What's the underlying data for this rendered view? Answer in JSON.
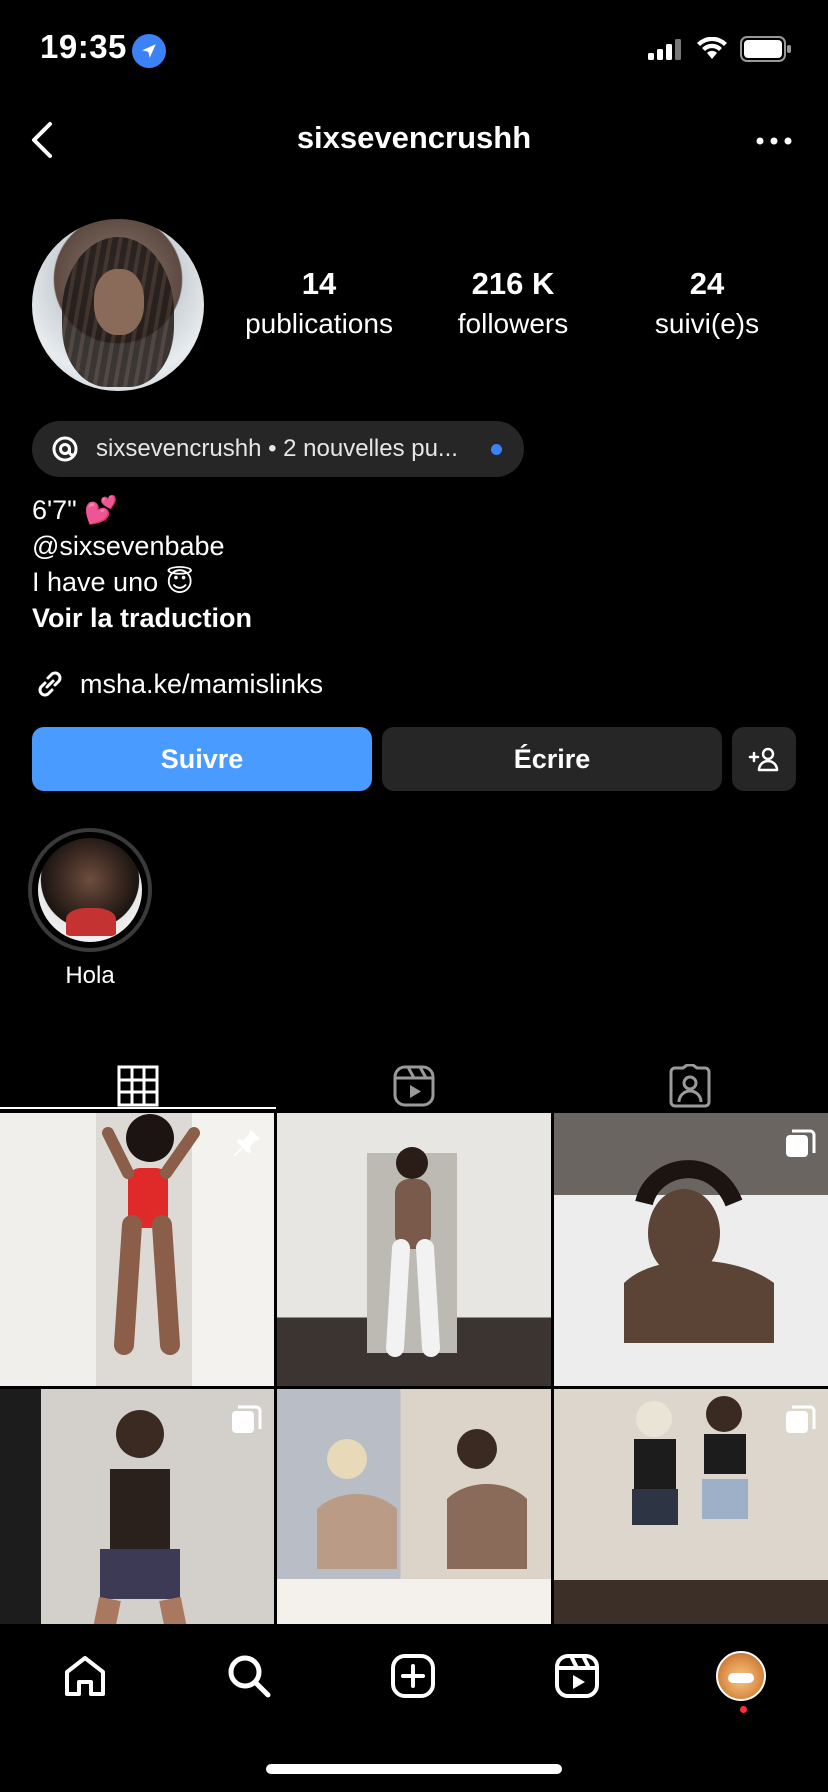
{
  "status_bar": {
    "time": "19:35",
    "icons": [
      "location-arrow-icon",
      "signal-icon",
      "wifi-icon",
      "battery-icon"
    ]
  },
  "header": {
    "username": "sixsevencrushh",
    "icons": [
      "back-chevron-icon",
      "more-dots-icon"
    ]
  },
  "stats": [
    {
      "value": "14",
      "label": "publications"
    },
    {
      "value": "216 K",
      "label": "followers"
    },
    {
      "value": "24",
      "label": "suivi(e)s"
    }
  ],
  "threads_pill": {
    "text": "sixsevencrushh • 2 nouvelles pu..."
  },
  "bio": {
    "line1": "6'7\" 💕",
    "line2": "@sixsevenbabe",
    "line3": "I have uno 😇",
    "translate": "Voir la traduction"
  },
  "link": {
    "text": "msha.ke/mamislinks"
  },
  "actions": {
    "follow": "Suivre",
    "message": "Écrire"
  },
  "highlights": [
    {
      "label": "Hola"
    }
  ],
  "tabs": [
    "grid-icon",
    "reels-icon",
    "tagged-icon"
  ],
  "grid": [
    {
      "badge": "pin-icon",
      "bg": "#e9e6e2",
      "accent": "#e02a2a"
    },
    {
      "badge": "",
      "bg": "#dcdad6",
      "accent": "#7a5a4a"
    },
    {
      "badge": "carousel-icon",
      "bg": "#d8d8d8",
      "accent": "#5b4336"
    },
    {
      "badge": "carousel-icon",
      "bg": "#c7c4bf",
      "accent": "#3b2a22"
    },
    {
      "badge": "",
      "bg": "#d9d1c6",
      "accent": "#8a6a58"
    },
    {
      "badge": "carousel-icon",
      "bg": "#cfc8bf",
      "accent": "#1c1c1c"
    }
  ],
  "colors": {
    "accent_blue": "#4a9bff",
    "button_dark": "#262626",
    "notification_red": "#ff2d3a"
  },
  "tabbar": [
    "home-icon",
    "search-icon",
    "create-icon",
    "reels-icon",
    "profile-avatar"
  ]
}
